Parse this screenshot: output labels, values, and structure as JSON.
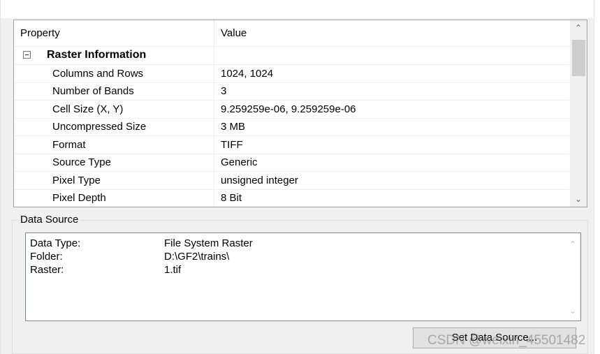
{
  "grid": {
    "header": {
      "property": "Property",
      "value": "Value"
    },
    "category": "Raster Information",
    "rows": [
      {
        "name": "Columns and Rows",
        "value": "1024, 1024"
      },
      {
        "name": "Number of Bands",
        "value": "3"
      },
      {
        "name": "Cell Size (X, Y)",
        "value": "9.259259e-06, 9.259259e-06"
      },
      {
        "name": "Uncompressed Size",
        "value": "3 MB"
      },
      {
        "name": "Format",
        "value": "TIFF"
      },
      {
        "name": "Source Type",
        "value": "Generic"
      },
      {
        "name": "Pixel Type",
        "value": "unsigned integer"
      },
      {
        "name": "Pixel Depth",
        "value": "8 Bit"
      }
    ],
    "scroll_up_icon": "chevron-up-icon",
    "scroll_down_icon": "chevron-down-icon"
  },
  "data_source": {
    "legend": "Data Source",
    "items": [
      {
        "label": "Data Type:",
        "value": "File System Raster"
      },
      {
        "label": "Folder:",
        "value": "D:\\GF2\\trains\\"
      },
      {
        "label": "Raster:",
        "value": "1.tif"
      }
    ],
    "button_label": "Set Data Source..."
  },
  "watermark": "CSDN @weixin_45501482"
}
